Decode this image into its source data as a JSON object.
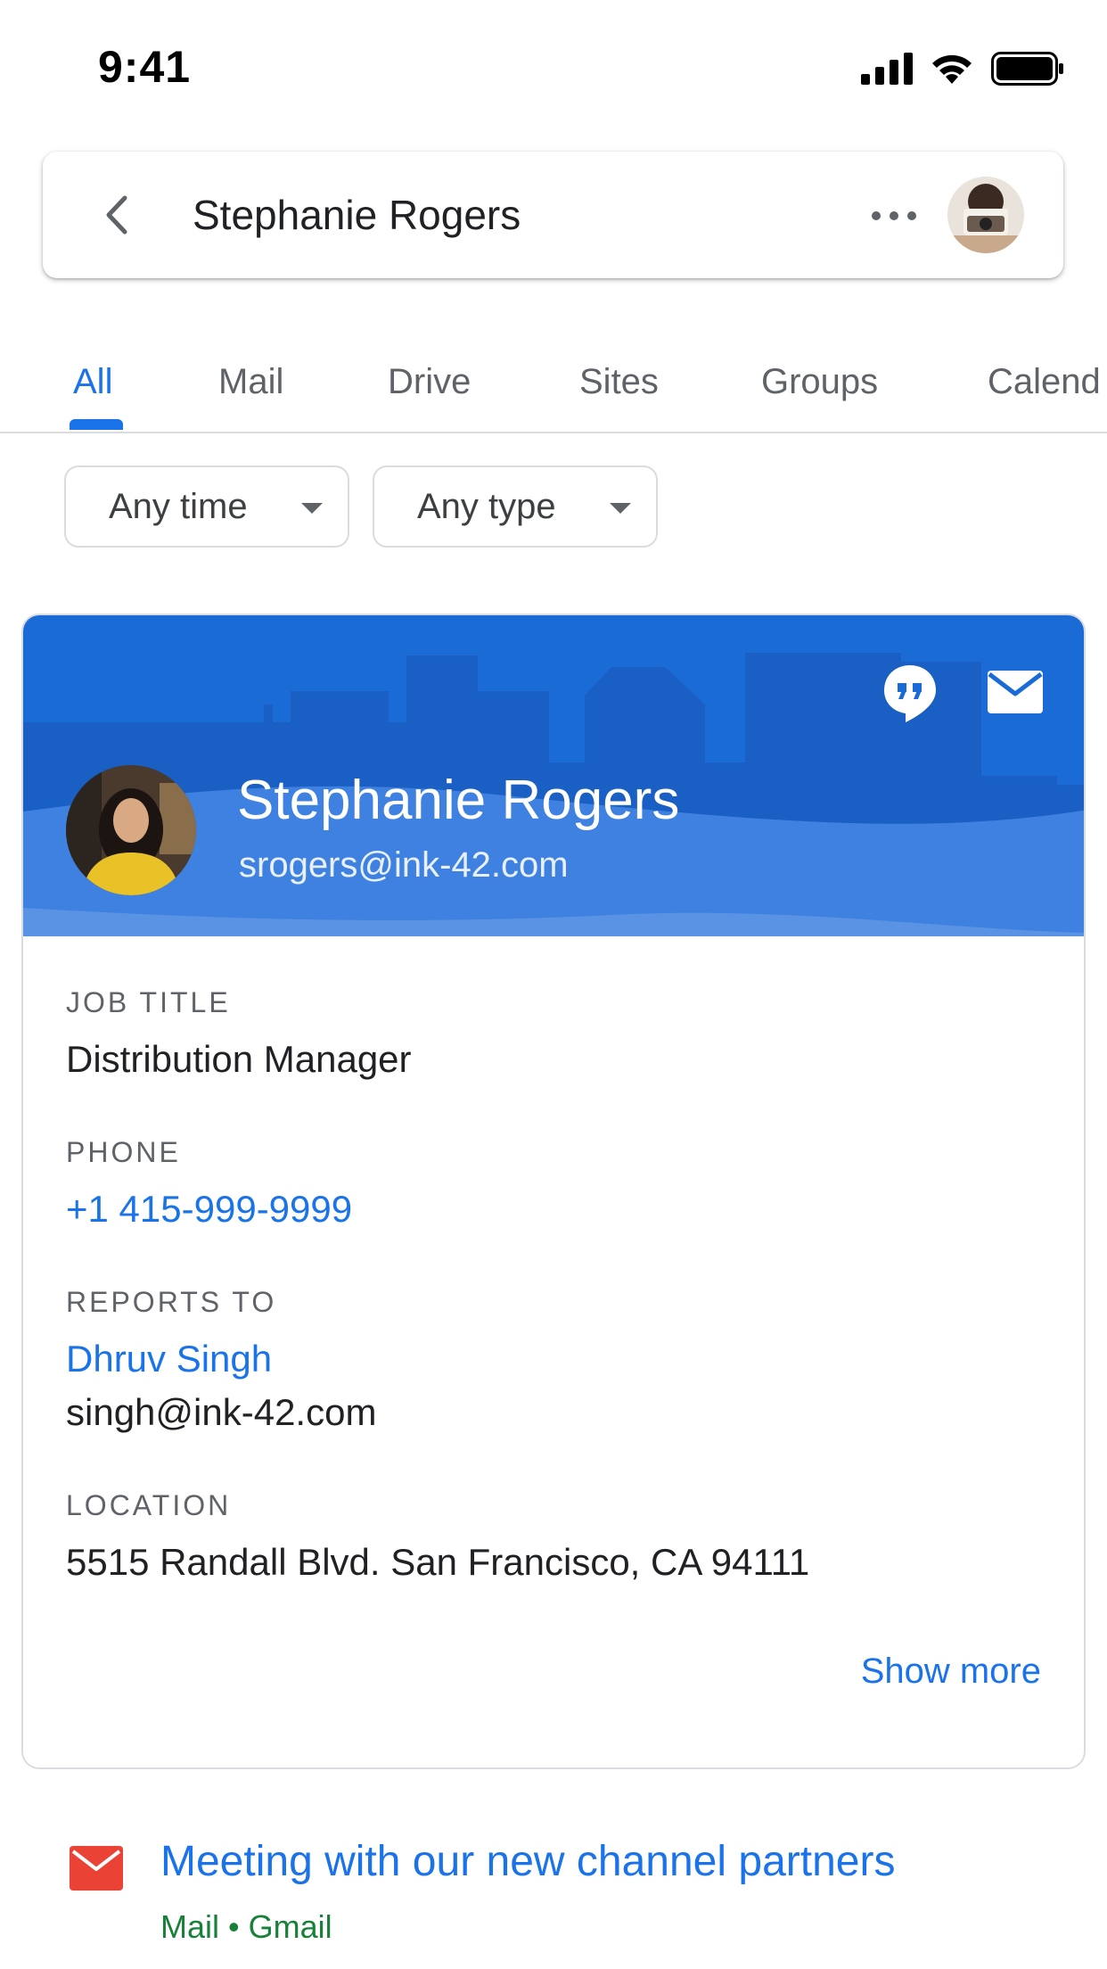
{
  "status_bar": {
    "time": "9:41"
  },
  "app_bar": {
    "title": "Stephanie Rogers"
  },
  "tabs": [
    {
      "label": "All",
      "active": true
    },
    {
      "label": "Mail"
    },
    {
      "label": "Drive"
    },
    {
      "label": "Sites"
    },
    {
      "label": "Groups"
    },
    {
      "label": "Calend"
    }
  ],
  "filters": [
    {
      "label": "Any time"
    },
    {
      "label": "Any type"
    }
  ],
  "contact": {
    "name": "Stephanie Rogers",
    "email": "srogers@ink-42.com",
    "fields": {
      "job_title_label": "JOB TITLE",
      "job_title": "Distribution Manager",
      "phone_label": "PHONE",
      "phone": "+1 415-999-9999",
      "reports_to_label": "REPORTS TO",
      "reports_to_name": "Dhruv Singh",
      "reports_to_email": "singh@ink-42.com",
      "location_label": "LOCATION",
      "location": "5515 Randall Blvd. San Francisco, CA 94111"
    },
    "show_more": "Show more"
  },
  "result": {
    "title": "Meeting with our new channel partners",
    "source": "Mail • Gmail"
  },
  "colors": {
    "accent": "#1a73e8",
    "header_blue": "#1a6bd6",
    "source_green": "#188038",
    "gmail_red": "#ea4335"
  }
}
